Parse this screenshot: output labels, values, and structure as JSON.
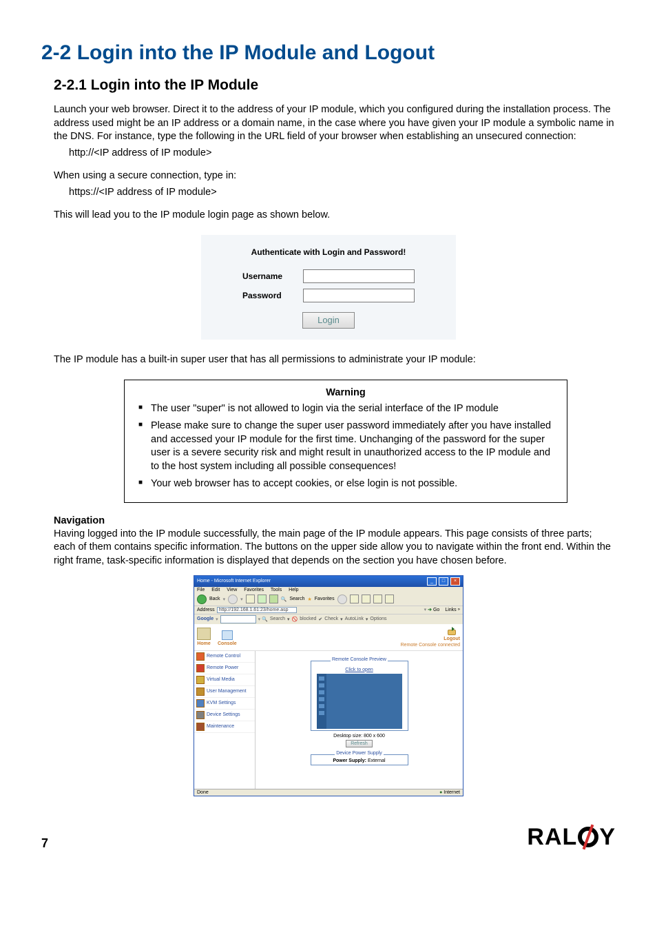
{
  "h1": "2-2  Login into the IP Module and Logout",
  "h2": "2-2.1  Login into the IP Module",
  "p1": "Launch your web browser. Direct it to the address of your IP module, which you configured during the installation process. The address used might be an IP address or a domain name, in the case where you have given your IP module a symbolic name in the DNS. For instance, type the following in the URL field of your browser when establishing an unsecured connection:",
  "p1_indent": "http://<IP address of IP module>",
  "p2": "When using a secure connection, type in:",
  "p2_indent": "https://<IP address of IP module>",
  "p3": "This will lead you to the IP module login page as shown below.",
  "login": {
    "title": "Authenticate with Login and Password!",
    "user_label": "Username",
    "pass_label": "Password",
    "button": "Login"
  },
  "p4": "The IP module has a built-in super user that has all permissions to administrate your IP module:",
  "warning": {
    "title": "Warning",
    "items": [
      "The user \"super\" is not allowed to login via the serial interface of the IP module",
      "Please make sure to change the super user password immediately after you have installed and accessed your IP module for the first time. Unchanging of the password for the super user is a severe security risk and might result in unauthorized access to the IP module and to the host system including all possible consequences!",
      "Your web browser has to accept cookies, or else login is not possible."
    ]
  },
  "nav_head": "Navigation",
  "nav_body": "Having logged into the IP module successfully, the main page of the IP module appears. This page consists of three parts; each of them contains specific information. The buttons on the upper side allow you to navigate within the front end. Within the right frame, task-specific information is displayed that depends on the section you have chosen before.",
  "ie": {
    "title": "Home - Microsoft Internet Explorer",
    "menu": [
      "File",
      "Edit",
      "View",
      "Favorites",
      "Tools",
      "Help"
    ],
    "back": "Back",
    "search": "Search",
    "favorites": "Favorites",
    "addr_label": "Address",
    "addr_value": "http://192.168.1.61:23/home.asp",
    "go": "Go",
    "links": "Links",
    "google_label": "Google",
    "google_items": [
      "Search",
      "blocked",
      "Check",
      "AutoLink",
      "Options"
    ],
    "top": {
      "home": "Home",
      "console": "Console",
      "status": "Remote Console connected",
      "logout": "Logout"
    },
    "side": [
      "Remote Control",
      "Remote Power",
      "Virtual Media",
      "User Management",
      "KVM Settings",
      "Device Settings",
      "Maintenance"
    ],
    "preview": {
      "title": "Remote Console Preview",
      "link": "Click to open",
      "desktop": "Desktop size: 800 x 600",
      "refresh": "Refresh"
    },
    "power": {
      "title": "Device Power Supply",
      "label": "Power Supply:",
      "value": "External"
    },
    "status_left": "Done",
    "status_right": "Internet"
  },
  "page_num": "7",
  "logo_text_pre": "RAL",
  "logo_text_post": "Y"
}
